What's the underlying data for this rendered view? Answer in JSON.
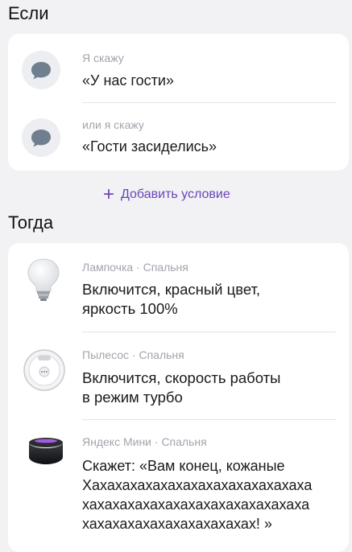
{
  "if_section": {
    "title": "Если",
    "conditions": [
      {
        "caption": "Я скажу",
        "phrase": "«У нас гости»"
      },
      {
        "caption": "или я скажу",
        "phrase": "«Гости засиделись»"
      }
    ],
    "add_condition_label": "Добавить условие"
  },
  "then_section": {
    "title": "Тогда",
    "actions": [
      {
        "device": "Лампочка",
        "room": "Спальня",
        "meta": "Лампочка · Спальня",
        "lines": [
          "Включится, красный цвет,",
          "яркость 100%"
        ]
      },
      {
        "device": "Пылесос",
        "room": "Спальня",
        "meta": "Пылесос · Спальня",
        "lines": [
          "Включится, скорость работы",
          "в режим турбо"
        ]
      },
      {
        "device": "Яндекс Мини",
        "room": "Спальня",
        "meta": "Яндекс Мини · Спальня",
        "lines": [
          "Скажет: «Вам конец, кожаные",
          "Хахахахахахахахахахахахахахаха",
          "хахахахахахахахахахахахахахаха",
          "хахахахахахахахахахахах! »"
        ]
      }
    ]
  },
  "colors": {
    "accent": "#6b45b8",
    "bubble": "#6f7f8f",
    "background": "#f2f2f5"
  }
}
